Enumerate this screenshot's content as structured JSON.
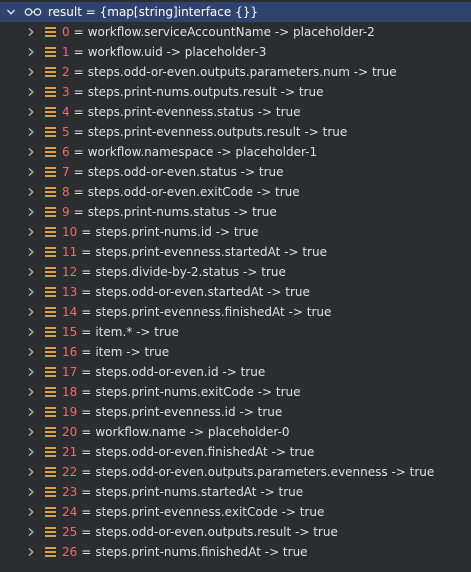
{
  "root": {
    "label": "result = {map[string]interface {}}"
  },
  "entries": [
    {
      "index": "0",
      "value": "workflow.serviceAccountName -> placeholder-2"
    },
    {
      "index": "1",
      "value": "workflow.uid -> placeholder-3"
    },
    {
      "index": "2",
      "value": "steps.odd-or-even.outputs.parameters.num -> true"
    },
    {
      "index": "3",
      "value": "steps.print-nums.outputs.result -> true"
    },
    {
      "index": "4",
      "value": "steps.print-evenness.status -> true"
    },
    {
      "index": "5",
      "value": "steps.print-evenness.outputs.result -> true"
    },
    {
      "index": "6",
      "value": "workflow.namespace -> placeholder-1"
    },
    {
      "index": "7",
      "value": "steps.odd-or-even.status -> true"
    },
    {
      "index": "8",
      "value": "steps.odd-or-even.exitCode -> true"
    },
    {
      "index": "9",
      "value": "steps.print-nums.status -> true"
    },
    {
      "index": "10",
      "value": "steps.print-nums.id -> true"
    },
    {
      "index": "11",
      "value": "steps.print-evenness.startedAt -> true"
    },
    {
      "index": "12",
      "value": "steps.divide-by-2.status -> true"
    },
    {
      "index": "13",
      "value": "steps.odd-or-even.startedAt -> true"
    },
    {
      "index": "14",
      "value": "steps.print-evenness.finishedAt -> true"
    },
    {
      "index": "15",
      "value": "item.* -> true"
    },
    {
      "index": "16",
      "value": "item -> true"
    },
    {
      "index": "17",
      "value": "steps.odd-or-even.id -> true"
    },
    {
      "index": "18",
      "value": "steps.print-nums.exitCode -> true"
    },
    {
      "index": "19",
      "value": "steps.print-evenness.id -> true"
    },
    {
      "index": "20",
      "value": "workflow.name -> placeholder-0"
    },
    {
      "index": "21",
      "value": "steps.odd-or-even.finishedAt -> true"
    },
    {
      "index": "22",
      "value": "steps.odd-or-even.outputs.parameters.evenness -> true"
    },
    {
      "index": "23",
      "value": "steps.print-nums.startedAt -> true"
    },
    {
      "index": "24",
      "value": "steps.print-evenness.exitCode -> true"
    },
    {
      "index": "25",
      "value": "steps.odd-or-even.outputs.result -> true"
    },
    {
      "index": "26",
      "value": "steps.print-nums.finishedAt -> true"
    }
  ],
  "separator": "=",
  "icons": {
    "root_toggle": "chevron-down-icon",
    "root_type": "watch-glasses-icon",
    "row_toggle": "chevron-right-icon",
    "row_type": "field-lines-icon"
  },
  "colors": {
    "background": "#2b2d30",
    "selection": "#2e436e",
    "index": "#f26b6b",
    "text": "#dfe1e5",
    "field_icon": "#d9a343",
    "chevron": "#b4b8bf"
  }
}
